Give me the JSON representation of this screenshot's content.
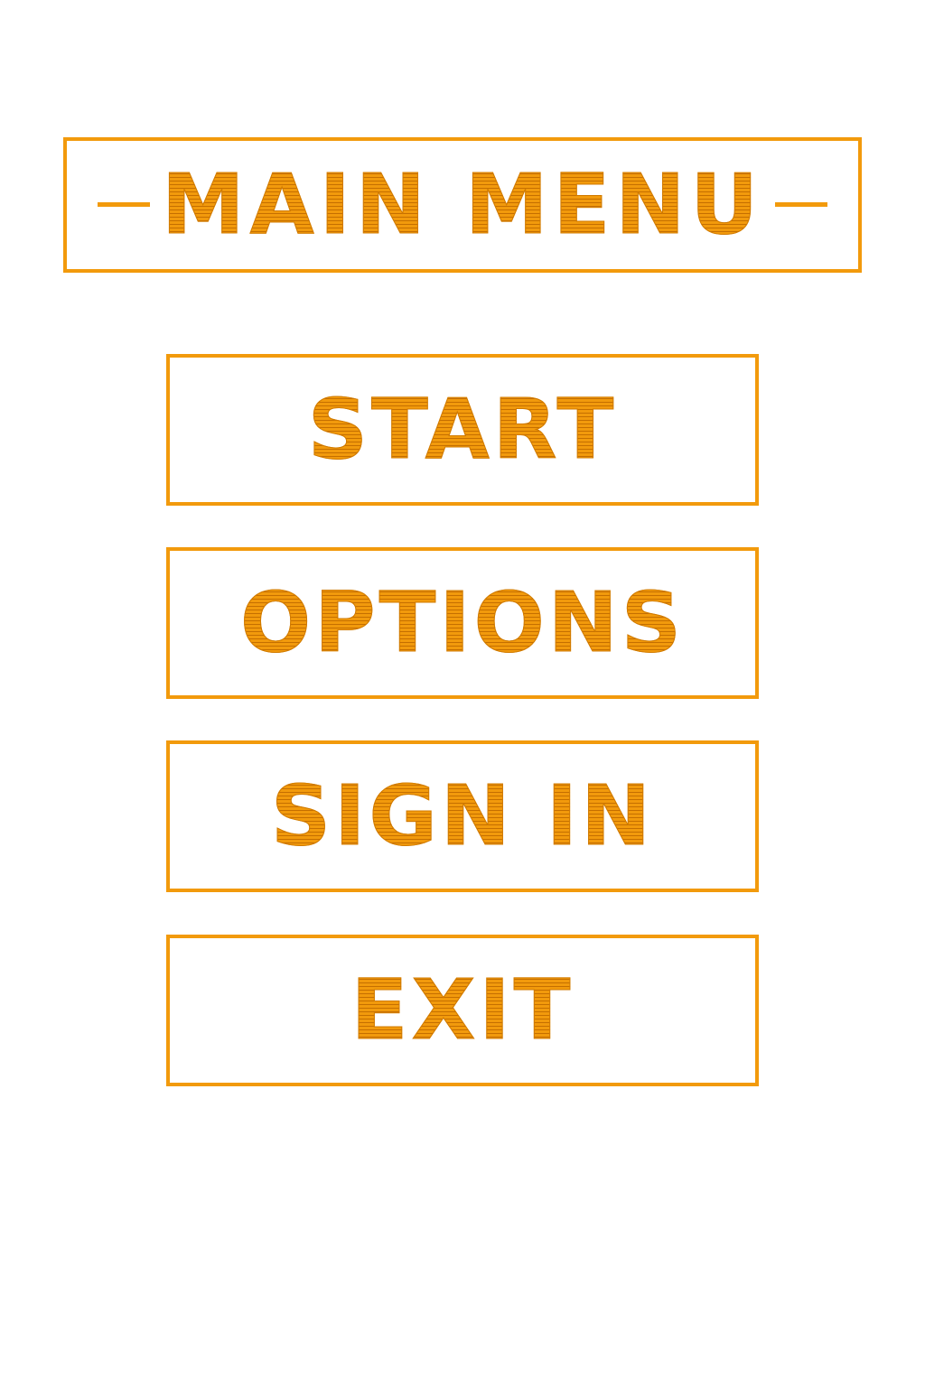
{
  "title": {
    "text": "MAIN MENU"
  },
  "menu": {
    "items": [
      {
        "label": "START"
      },
      {
        "label": "OPTIONS"
      },
      {
        "label": "SIGN IN"
      },
      {
        "label": "EXIT"
      }
    ]
  },
  "colors": {
    "accent": "#f29a0c",
    "background": "#ffffff"
  }
}
